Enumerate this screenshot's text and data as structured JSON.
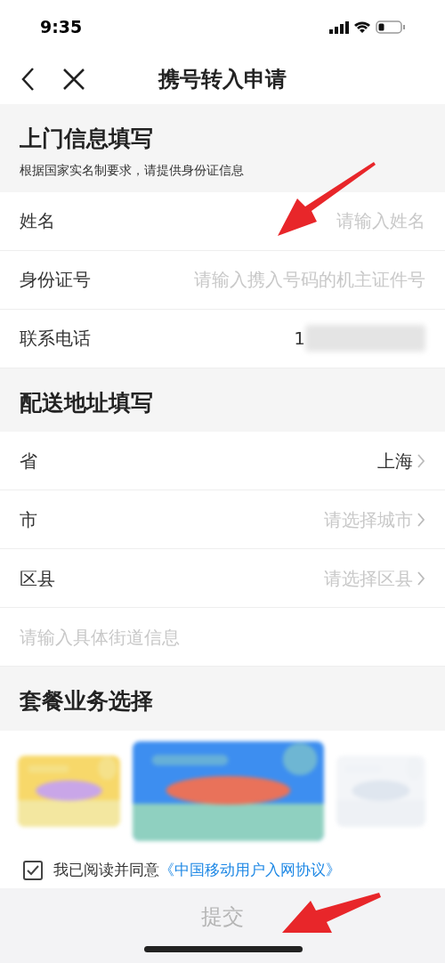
{
  "status_bar": {
    "time": "9:35"
  },
  "nav": {
    "title": "携号转入申请"
  },
  "sections": [
    {
      "title": "上门信息填写",
      "subtitle": "根据国家实名制要求，请提供身份证信息",
      "rows": [
        {
          "kind": "input",
          "label": "姓名",
          "placeholder": "请输入姓名"
        },
        {
          "kind": "input",
          "label": "身份证号",
          "placeholder": "请输入携入号码的机主证件号"
        },
        {
          "kind": "display",
          "label": "联系电话",
          "value": "1"
        }
      ]
    },
    {
      "title": "配送地址填写",
      "rows": [
        {
          "kind": "select",
          "label": "省",
          "value": "上海"
        },
        {
          "kind": "select",
          "label": "市",
          "placeholder": "请选择城市"
        },
        {
          "kind": "select",
          "label": "区县",
          "placeholder": "请选择区县"
        },
        {
          "kind": "street",
          "placeholder": "请输入具体街道信息"
        }
      ]
    },
    {
      "title": "套餐业务选择"
    }
  ],
  "agreement": {
    "checked": true,
    "text": "我已阅读并同意",
    "link": "《中国移动用户入网协议》"
  },
  "submit": {
    "label": "提交",
    "disabled": true
  }
}
